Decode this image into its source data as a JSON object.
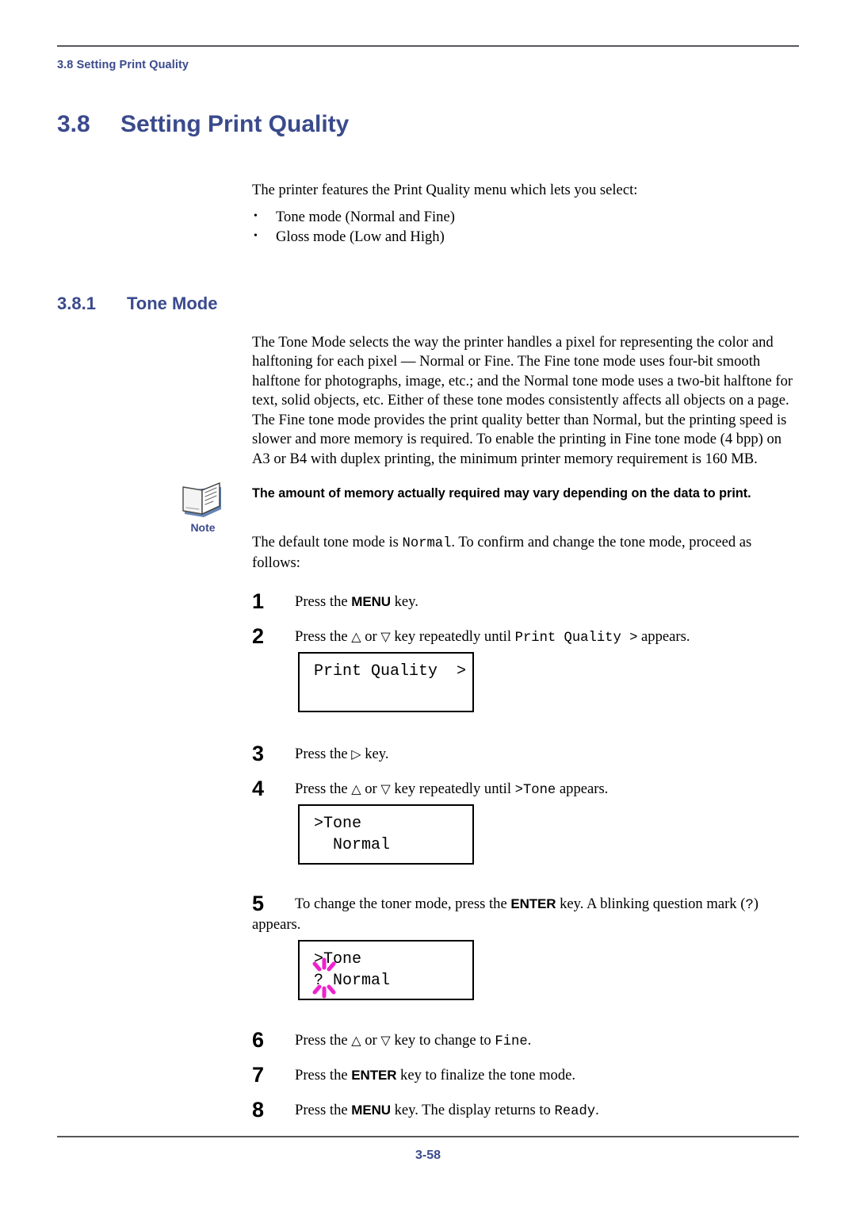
{
  "header": {
    "running_header": "3.8 Setting Print Quality"
  },
  "headings": {
    "section_number": "3.8",
    "section_title": "Setting Print Quality",
    "subsection_number": "3.8.1",
    "subsection_title": "Tone Mode"
  },
  "intro": {
    "lead": "The printer features the Print Quality menu which lets you select:",
    "bullets": [
      "Tone mode (Normal and Fine)",
      "Gloss mode (Low and High)"
    ]
  },
  "paragraphs": {
    "p1": "The Tone Mode selects the way the printer handles a pixel for representing the color and halftoning for each pixel — Normal or Fine. The Fine tone mode uses four-bit smooth halftone for photographs, image, etc.; and the Normal tone mode uses a two-bit halftone for text, solid objects, etc. Either of these tone modes consistently affects all objects on a page.",
    "p2": "The Fine tone mode provides the print quality better than Normal, but the printing speed is slower and more memory is required. To enable the printing in Fine tone mode (4 bpp) on A3 or B4 with duplex printing, the minimum printer memory requirement is 160 MB."
  },
  "note": {
    "label": "Note",
    "icon": "note-book-icon",
    "text": "The amount of memory actually required may vary depending on the data to print."
  },
  "default_mode": {
    "before": "The default tone mode is ",
    "mono": "Normal",
    "after": ". To confirm and change the tone mode, proceed as follows:"
  },
  "steps": [
    {
      "number": "1",
      "parts": [
        {
          "t": "text",
          "v": "Press the "
        },
        {
          "t": "kbd",
          "v": "MENU"
        },
        {
          "t": "text",
          "v": " key."
        }
      ]
    },
    {
      "number": "2",
      "parts": [
        {
          "t": "text",
          "v": "Press the "
        },
        {
          "t": "tri",
          "v": "△"
        },
        {
          "t": "text",
          "v": " or "
        },
        {
          "t": "tri",
          "v": "▽"
        },
        {
          "t": "text",
          "v": " key repeatedly until "
        },
        {
          "t": "mono",
          "v": "Print Quality >"
        },
        {
          "t": "text",
          "v": " appears."
        }
      ]
    },
    {
      "number": "3",
      "parts": [
        {
          "t": "text",
          "v": "Press the "
        },
        {
          "t": "tri",
          "v": "▷"
        },
        {
          "t": "text",
          "v": " key."
        }
      ]
    },
    {
      "number": "4",
      "parts": [
        {
          "t": "text",
          "v": "Press the "
        },
        {
          "t": "tri",
          "v": "△"
        },
        {
          "t": "text",
          "v": " or "
        },
        {
          "t": "tri",
          "v": "▽"
        },
        {
          "t": "text",
          "v": " key repeatedly until "
        },
        {
          "t": "mono",
          "v": ">Tone"
        },
        {
          "t": "text",
          "v": " appears."
        }
      ]
    },
    {
      "number": "5",
      "parts": [
        {
          "t": "text",
          "v": "To change the toner mode, press the "
        },
        {
          "t": "kbd",
          "v": "ENTER"
        },
        {
          "t": "text",
          "v": " key. A blinking question mark ("
        },
        {
          "t": "mono",
          "v": "?"
        },
        {
          "t": "text",
          "v": ") appears."
        }
      ]
    },
    {
      "number": "6",
      "parts": [
        {
          "t": "text",
          "v": "Press the "
        },
        {
          "t": "tri",
          "v": "△"
        },
        {
          "t": "text",
          "v": " or "
        },
        {
          "t": "tri",
          "v": "▽"
        },
        {
          "t": "text",
          "v": " key to change to "
        },
        {
          "t": "mono",
          "v": "Fine"
        },
        {
          "t": "text",
          "v": "."
        }
      ]
    },
    {
      "number": "7",
      "parts": [
        {
          "t": "text",
          "v": "Press the "
        },
        {
          "t": "kbd",
          "v": "ENTER"
        },
        {
          "t": "text",
          "v": " key to finalize the tone mode."
        }
      ]
    },
    {
      "number": "8",
      "parts": [
        {
          "t": "text",
          "v": "Press the "
        },
        {
          "t": "kbd",
          "v": "MENU"
        },
        {
          "t": "text",
          "v": " key. The display returns to "
        },
        {
          "t": "mono",
          "v": "Ready"
        },
        {
          "t": "text",
          "v": "."
        }
      ]
    }
  ],
  "lcd_panels": [
    {
      "id": "lcd-print-quality",
      "line1": "Print Quality  >",
      "line2": "",
      "blinking": false
    },
    {
      "id": "lcd-tone-normal",
      "line1": ">Tone",
      "line2": "  Normal",
      "blinking": false
    },
    {
      "id": "lcd-tone-normal-blinking",
      "line1": ">Tone",
      "line2_prefix": "?",
      "line2_rest": " Normal",
      "blinking": true,
      "blink_color": "#ee22cc"
    }
  ],
  "footer": {
    "page_number": "3-58"
  },
  "colors": {
    "heading_blue": "#3a4a8c",
    "rule_gray": "#58585c",
    "blink_magenta": "#ee22cc",
    "text_black": "#000000"
  }
}
